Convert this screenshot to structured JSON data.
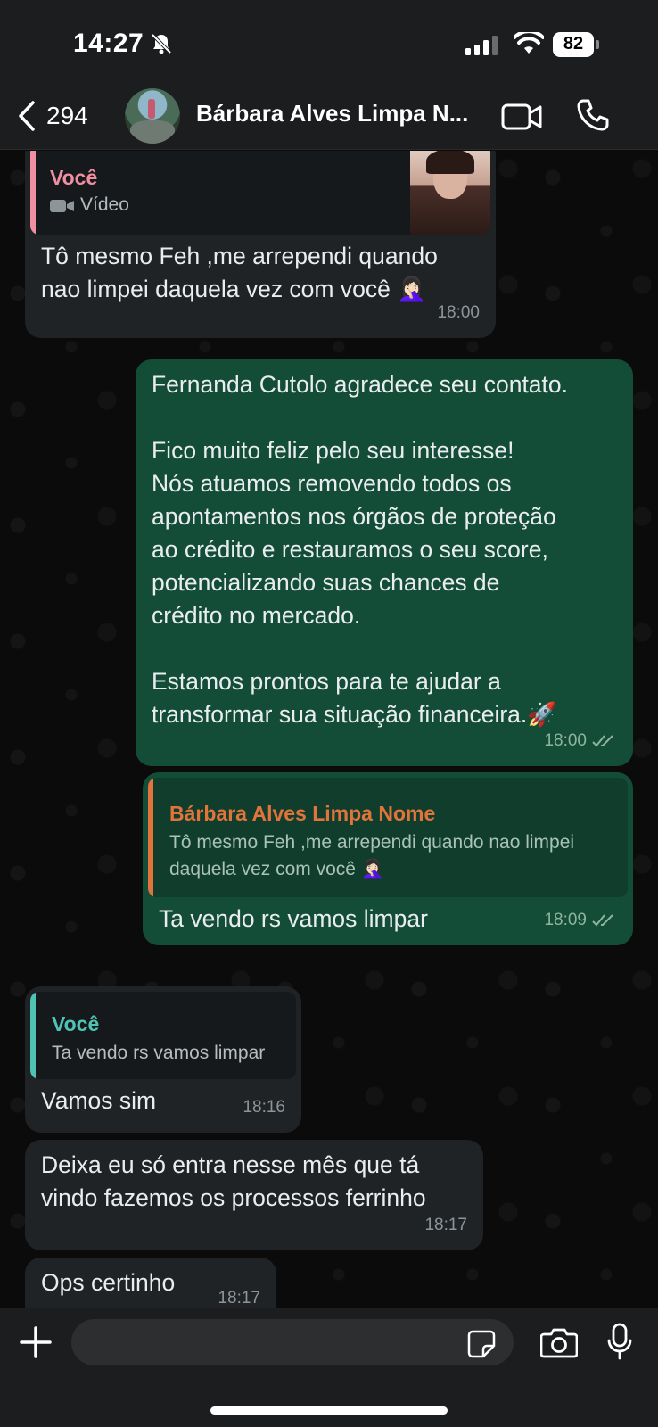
{
  "status_bar": {
    "time": "14:27",
    "battery": "82"
  },
  "header": {
    "back_count": "294",
    "contact_name": "Bárbara Alves Limpa N..."
  },
  "messages": {
    "m1": {
      "quote_name": "Você",
      "quote_sub": "Vídeo",
      "text_line1": "Tô mesmo Feh ,me arrependi quando",
      "text_line2": "nao limpei daquela vez com você 🤦🏻‍♀️",
      "time": "18:00"
    },
    "m2": {
      "lines": [
        "Fernanda Cutolo agradece seu contato.",
        "",
        "Fico muito feliz pelo seu interesse!",
        "Nós atuamos removendo todos os",
        "apontamentos nos órgãos de proteção",
        "ao crédito e restauramos o seu score,",
        "potencializando suas chances de",
        "crédito no mercado.",
        "",
        "Estamos prontos para te ajudar a",
        "transformar sua situação financeira.🚀"
      ],
      "time": "18:00"
    },
    "m3": {
      "quote_name": "Bárbara Alves Limpa Nome",
      "quote_line1": "Tô mesmo Feh ,me arrependi quando nao limpei",
      "quote_line2": "daquela vez com você 🤦🏻‍♀️",
      "text": "Ta vendo rs vamos limpar",
      "time": "18:09"
    },
    "m4": {
      "quote_name": "Você",
      "quote_sub": "Ta vendo rs vamos limpar",
      "text": "Vamos sim",
      "time": "18:16"
    },
    "m5": {
      "text_line1": "Deixa eu só entra nesse mês que tá",
      "text_line2": "vindo fazemos os processos ferrinho",
      "time": "18:17"
    },
    "m6": {
      "text": "Ops certinho",
      "time": "18:17"
    }
  },
  "colors": {
    "incoming_bubble": "#1f2326",
    "outgoing_bubble": "#144d37",
    "quote_pink": "#ef8fa1",
    "quote_orange": "#e0743b",
    "quote_teal": "#4fc3b4"
  }
}
